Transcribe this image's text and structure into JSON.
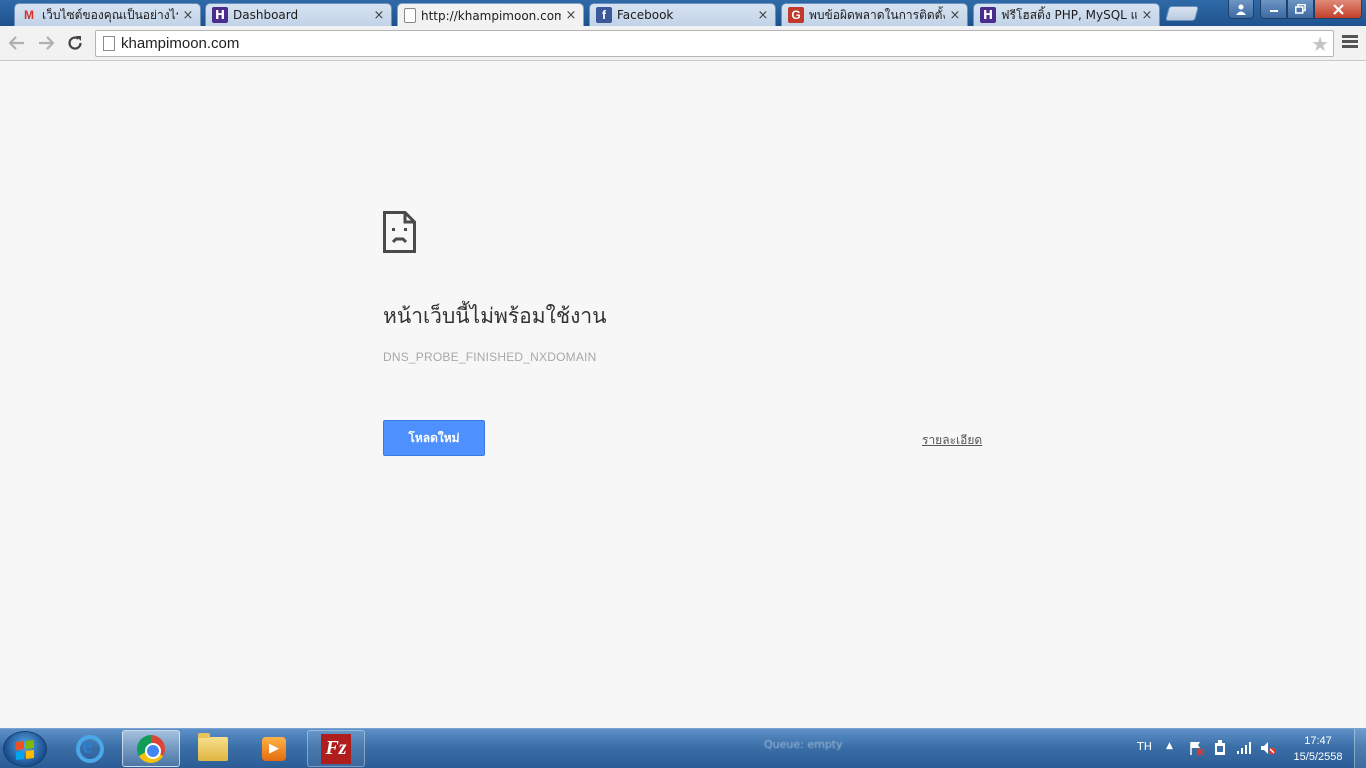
{
  "browser": {
    "tabs": [
      {
        "title": "เว็บไซต์ของคุณเป็นอย่างไรบ้าง",
        "icon": "gmail-icon",
        "active": false
      },
      {
        "title": "Dashboard",
        "icon": "hostinger-icon",
        "active": false
      },
      {
        "title": "http://khampimoon.com/",
        "icon": "page-icon",
        "active": true
      },
      {
        "title": "Facebook",
        "icon": "facebook-icon",
        "active": false
      },
      {
        "title": "พบข้อผิดพลาดในการติดตั้ง ใช้",
        "icon": "g-icon",
        "active": false
      },
      {
        "title": "ฟรีโฮสติ้ง PHP, MySQL และ",
        "icon": "hostinger-icon",
        "active": false
      }
    ],
    "tab_close_glyph": "×",
    "address": "khampimoon.com"
  },
  "error_page": {
    "title": "หน้าเว็บนี้ไม่พร้อมใช้งาน",
    "error_code": "DNS_PROBE_FINISHED_NXDOMAIN",
    "reload_button": "โหลดใหม่",
    "details_link": "รายละเอียด"
  },
  "taskbar": {
    "queue_text": "Queue: empty",
    "language": "TH",
    "time": "17:47",
    "date": "15/5/2558"
  },
  "colors": {
    "accent_blue": "#4d90fe",
    "page_background": "#f7f7f7",
    "taskbar": "#3b6fa8"
  }
}
